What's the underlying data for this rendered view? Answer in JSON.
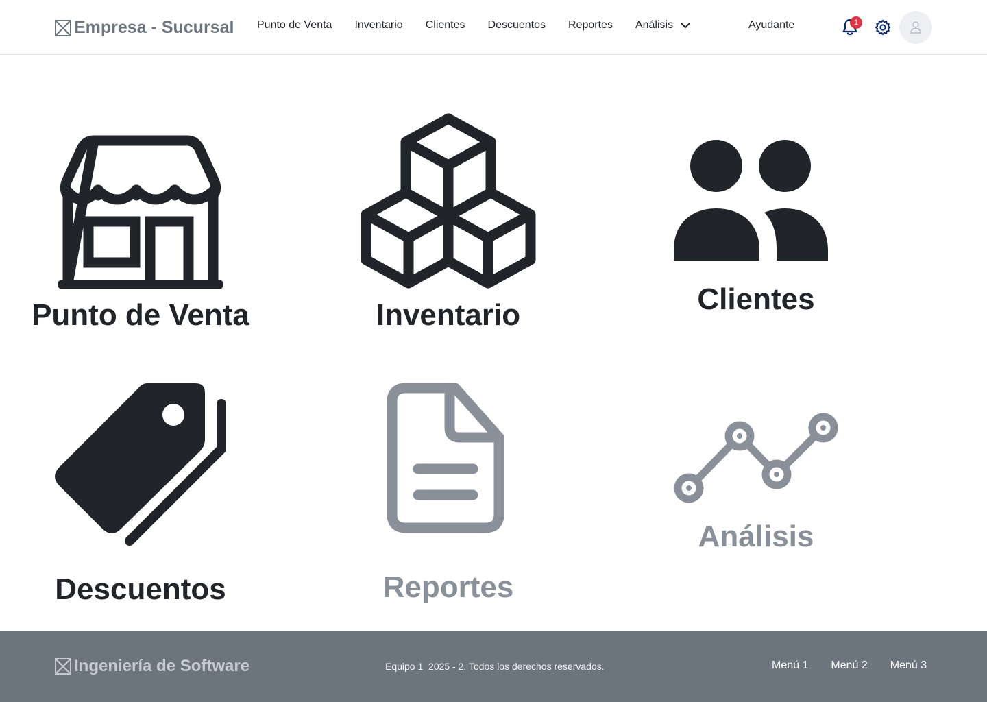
{
  "header": {
    "brand": "Empresa - Sucursal",
    "nav": [
      "Punto de Venta",
      "Inventario",
      "Clientes",
      "Descuentos",
      "Reportes",
      "Análisis"
    ],
    "helper": "Ayudante",
    "notification_count": "1"
  },
  "tiles": [
    {
      "label": "Punto de Venta",
      "icon": "store-icon"
    },
    {
      "label": "Inventario",
      "icon": "boxes-icon"
    },
    {
      "label": "Clientes",
      "icon": "people-icon"
    },
    {
      "label": "Descuentos",
      "icon": "tags-icon"
    },
    {
      "label": "Reportes",
      "icon": "document-icon"
    },
    {
      "label": "Análisis",
      "icon": "line-graph-icon"
    }
  ],
  "footer": {
    "brand": "Ingeniería de Software",
    "copyright": "Equipo 1  2025 - 2. Todos los derechos reservados.",
    "menus": [
      "Menú 1",
      "Menú 2",
      "Menú 3"
    ]
  },
  "colors": {
    "text_dark": "#212529",
    "text_muted": "#8a9099",
    "footer_bg": "#6c757d",
    "badge": "#dc3545",
    "icon_accent": "#0d2a6b"
  }
}
